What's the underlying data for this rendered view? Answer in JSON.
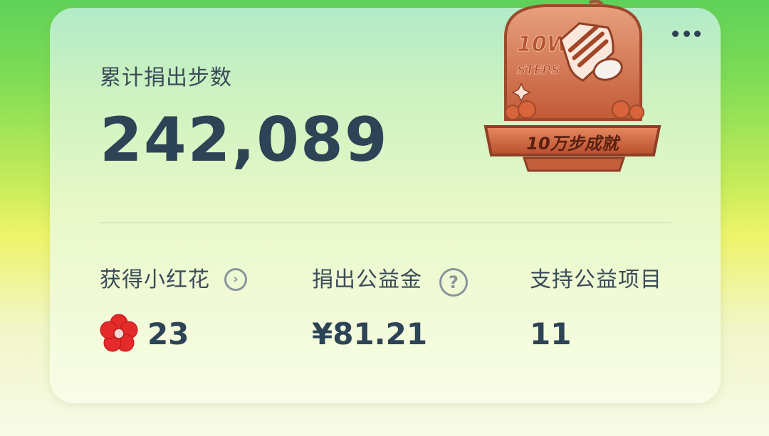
{
  "card": {
    "title": "累计捐出步数",
    "total_steps": "242,089"
  },
  "badge": {
    "top_text": "10W",
    "steps_text": "STEPS",
    "ribbon_text": "10万步成就",
    "icon": "sneaker-medal-icon"
  },
  "stats": {
    "flowers": {
      "label": "获得小红花",
      "value": "23",
      "icon": "red-flower-icon",
      "action_icon": "chevron-right-circle-icon"
    },
    "donation": {
      "label": "捐出公益金",
      "value": "¥81.21",
      "action_icon": "question-circle-icon"
    },
    "projects": {
      "label": "支持公益项目",
      "value": "11"
    }
  },
  "colors": {
    "text_primary": "#2d4356",
    "text_secondary": "#3b4b59",
    "icon_gray": "#8a949c",
    "flower_red": "#e52a2a",
    "badge_copper": "#c96a45"
  }
}
